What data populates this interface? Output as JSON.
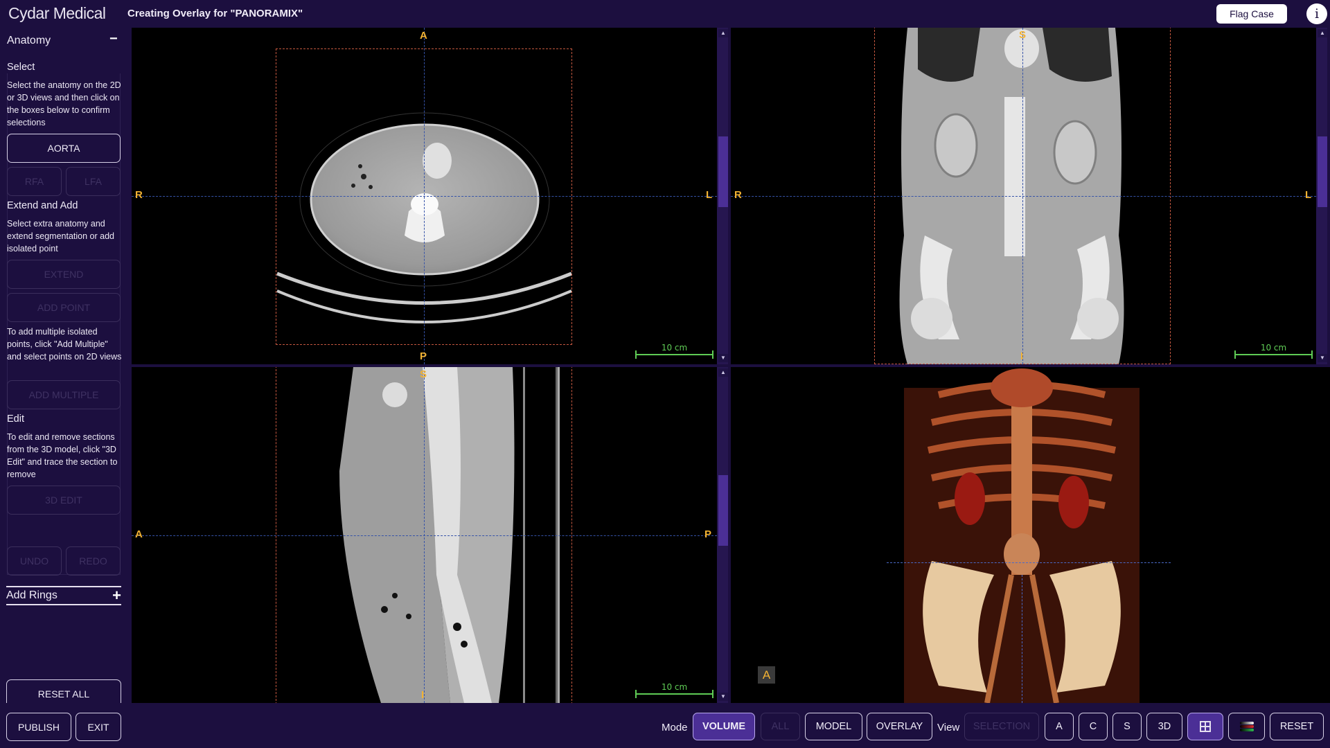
{
  "header": {
    "logo": "Cydar Medical",
    "title": "Creating Overlay for \"PANORAMIX\"",
    "flag_case": "Flag Case",
    "info": "i"
  },
  "sidebar": {
    "anatomy": {
      "title": "Anatomy",
      "toggle": "−"
    },
    "select": {
      "title": "Select",
      "help": "Select the anatomy on the 2D or 3D views and then click on the boxes below to confirm selections",
      "buttons": {
        "aorta": "AORTA",
        "rfa": "RFA",
        "lfa": "LFA"
      }
    },
    "extend": {
      "title": "Extend and Add",
      "help": "Select extra anatomy and extend segmentation or add isolated point",
      "extend_btn": "EXTEND",
      "add_point_btn": "ADD POINT",
      "multi_help": "To add multiple isolated points, click \"Add Multiple\" and select points on 2D views",
      "add_multiple_btn": "ADD MULTIPLE"
    },
    "edit": {
      "title": "Edit",
      "help": "To edit and remove sections from the 3D model, click \"3D Edit\" and trace the section to remove",
      "edit_btn": "3D EDIT",
      "undo": "UNDO",
      "redo": "REDO"
    },
    "rings": {
      "title": "Add Rings",
      "toggle": "+"
    },
    "reset_all": "RESET ALL",
    "publish": "PUBLISH",
    "exit": "EXIT"
  },
  "viewports": {
    "axial": {
      "top": "A",
      "bottom": "P",
      "left": "R",
      "right": "L",
      "scale": "10 cm",
      "scroll_position": 0.4
    },
    "coronal": {
      "top": "S",
      "bottom": "I",
      "left": "R",
      "right": "L",
      "scale": "10 cm",
      "scroll_position": 0.4
    },
    "sagittal": {
      "top": "S",
      "bottom": "I",
      "left": "A",
      "right": "P",
      "scale": "10 cm",
      "scroll_position": 0.4
    },
    "volume3d": {
      "orientation_badge": "A"
    }
  },
  "toolbar": {
    "mode_label": "Mode",
    "modes": {
      "volume": "VOLUME",
      "all": "ALL",
      "model": "MODEL",
      "overlay": "OVERLAY"
    },
    "view_label": "View",
    "views": {
      "selection": "SELECTION",
      "a": "A",
      "c": "C",
      "s": "S",
      "three_d": "3D"
    },
    "reset": "RESET",
    "colors": {
      "accent": "#4b2f96",
      "background": "#1c0f3f",
      "orientation": "#f2b233",
      "scale": "#5fcc55",
      "roi": "#c4573f"
    }
  }
}
